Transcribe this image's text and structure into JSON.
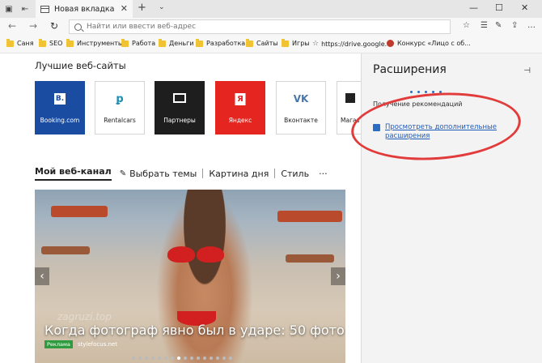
{
  "window": {
    "tab_title": "Новая вкладка",
    "tab_close": "✕",
    "new_tab": "+",
    "tab_menu": "⌄",
    "minimize": "—",
    "maximize": "☐",
    "close": "✕"
  },
  "address_bar": {
    "placeholder": "Найти или ввести веб-адрес",
    "back": "←",
    "forward": "→",
    "refresh": "↻"
  },
  "toolbar": {
    "favorites": "☆",
    "hub": "☰",
    "notes": "✎",
    "share": "⇪",
    "more": "…"
  },
  "favorites": [
    {
      "type": "folder",
      "label": "Саня"
    },
    {
      "type": "folder",
      "label": "SEO"
    },
    {
      "type": "folder",
      "label": "Инструменты"
    },
    {
      "type": "folder",
      "label": "Работа"
    },
    {
      "type": "folder",
      "label": "Деньги"
    },
    {
      "type": "folder",
      "label": "Разработка"
    },
    {
      "type": "folder",
      "label": "Сайты"
    },
    {
      "type": "folder",
      "label": "Игры"
    },
    {
      "type": "link",
      "label": "https://drive.google.c"
    },
    {
      "type": "site",
      "label": "Конкурс «Лицо с об..."
    }
  ],
  "top_sites": {
    "heading": "Лучшие веб-сайты",
    "tiles": [
      {
        "label": "Booking.com",
        "logo": "B."
      },
      {
        "label": "Rentalcars",
        "logo": "ꝑ"
      },
      {
        "label": "Партнеры",
        "logo": ""
      },
      {
        "label": "Яндекс",
        "logo": "Я"
      },
      {
        "label": "Вконтакте",
        "logo": "VK"
      },
      {
        "label": "Магаз",
        "logo": ""
      }
    ]
  },
  "feed": {
    "tabs": {
      "my_feed": "Мой веб-канал",
      "pick_topics": "Выбрать темы",
      "picture": "Картина дня",
      "style": "Стиль",
      "more": "···"
    },
    "hero": {
      "caption": "Когда фотограф явно был в ударе: 50 фото",
      "ad_badge": "Реклама",
      "source": "stylefocus.net",
      "watermark": "zagruzi.top",
      "prev": "‹",
      "next": "›",
      "dot_count": 16,
      "active_dot": 7
    }
  },
  "extensions_panel": {
    "title": "Расширения",
    "pin": "⊣",
    "status": "Получение рекомендаций",
    "store_link": "Просмотреть дополнительные расширения"
  },
  "colors": {
    "annotation_ring": "#e23b3b",
    "link": "#1e5bb8",
    "booking": "#1a4da1",
    "yandex": "#e52620"
  }
}
